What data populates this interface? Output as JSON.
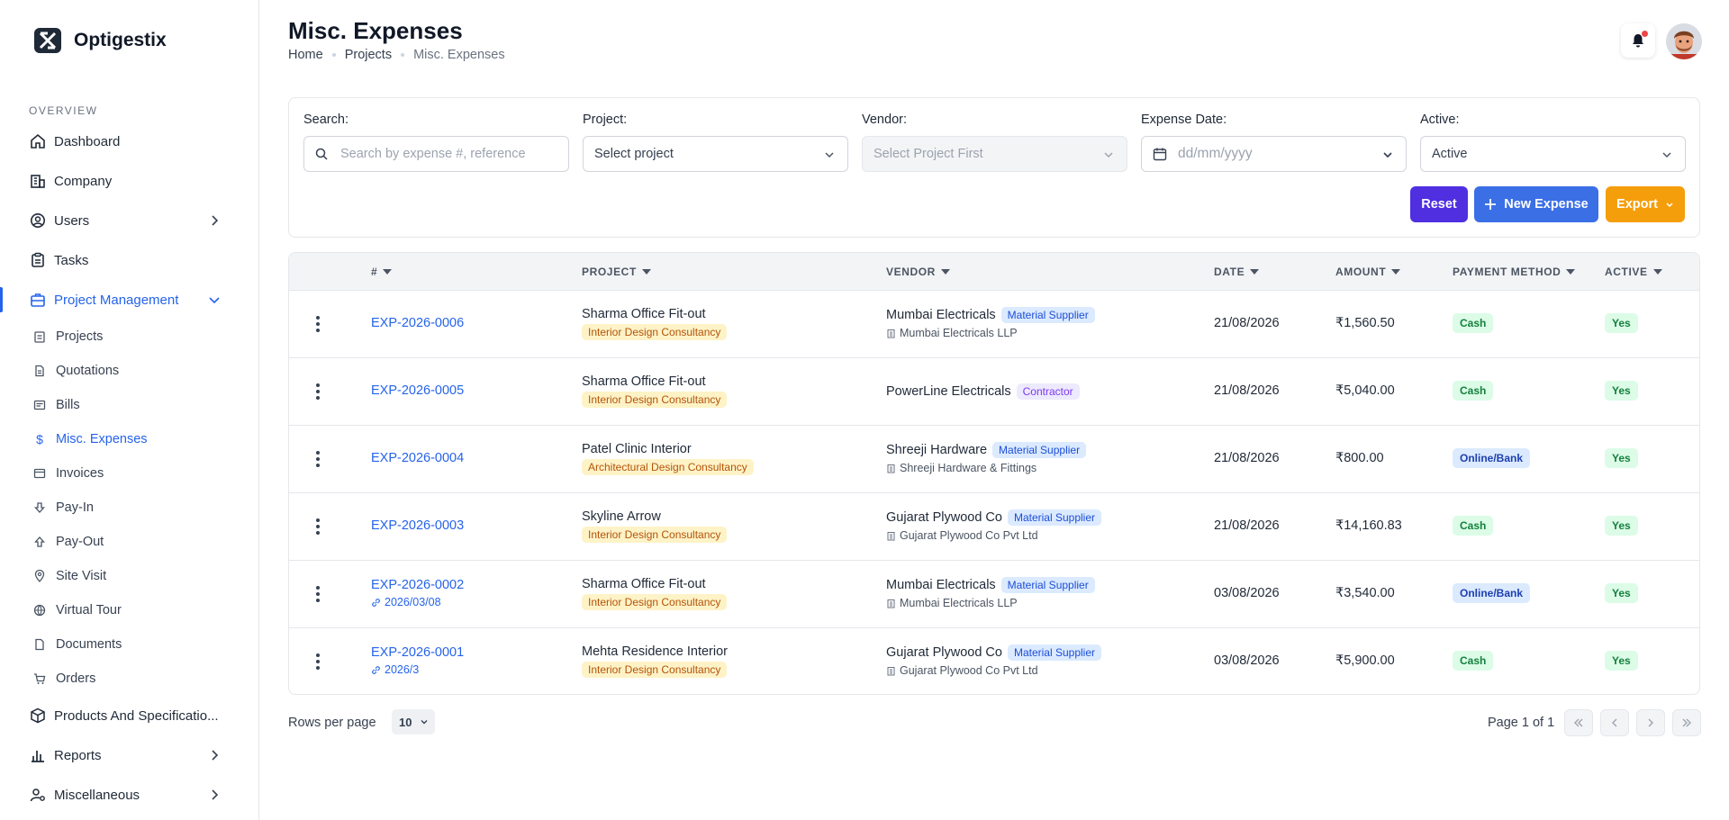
{
  "brand": {
    "name": "Optigestix"
  },
  "sidebar": {
    "section_label": "OVERVIEW",
    "items": [
      {
        "label": "Dashboard",
        "icon": "home-icon"
      },
      {
        "label": "Company",
        "icon": "building-icon"
      },
      {
        "label": "Users",
        "icon": "user-circle-icon",
        "expandable": true
      },
      {
        "label": "Tasks",
        "icon": "clipboard-icon"
      },
      {
        "label": "Project Management",
        "icon": "briefcase-icon",
        "expanded": true,
        "active": true
      }
    ],
    "sub_items": [
      {
        "label": "Projects",
        "icon": "clipboard-icon"
      },
      {
        "label": "Quotations",
        "icon": "document-icon"
      },
      {
        "label": "Bills",
        "icon": "receipt-icon"
      },
      {
        "label": "Misc. Expenses",
        "icon": "dollar-icon",
        "active": true
      },
      {
        "label": "Invoices",
        "icon": "invoice-icon"
      },
      {
        "label": "Pay-In",
        "icon": "arrow-down-icon"
      },
      {
        "label": "Pay-Out",
        "icon": "arrow-up-icon"
      },
      {
        "label": "Site Visit",
        "icon": "map-pin-icon"
      },
      {
        "label": "Virtual Tour",
        "icon": "globe-icon"
      },
      {
        "label": "Documents",
        "icon": "file-icon"
      },
      {
        "label": "Orders",
        "icon": "cart-icon"
      }
    ],
    "bottom_items": [
      {
        "label": "Products And Specificatio...",
        "icon": "box-icon"
      },
      {
        "label": "Reports",
        "icon": "bar-chart-icon",
        "expandable": true
      },
      {
        "label": "Miscellaneous",
        "icon": "user-settings-icon",
        "expandable": true
      }
    ]
  },
  "header": {
    "title": "Misc. Expenses",
    "breadcrumb": [
      "Home",
      "Projects",
      "Misc. Expenses"
    ]
  },
  "filters": {
    "search": {
      "label": "Search:",
      "placeholder": "Search by expense #, reference"
    },
    "project": {
      "label": "Project:",
      "value": "Select project"
    },
    "vendor": {
      "label": "Vendor:",
      "value": "Select Project First"
    },
    "date": {
      "label": "Expense Date:",
      "placeholder": "dd/mm/yyyy"
    },
    "active": {
      "label": "Active:",
      "value": "Active"
    },
    "buttons": {
      "reset": "Reset",
      "new": "New Expense",
      "export": "Export"
    }
  },
  "table": {
    "columns": [
      "#",
      "PROJECT",
      "VENDOR",
      "DATE",
      "AMOUNT",
      "PAYMENT METHOD",
      "ACTIVE"
    ],
    "rows": [
      {
        "id": "EXP-2026-0006",
        "ref": "",
        "project": "Sharma Office Fit-out",
        "project_tag": "Interior Design Consultancy",
        "vendor": "Mumbai Electricals",
        "vendor_tag": "Material Supplier",
        "vendor_tag_color": "blue",
        "vendor_sub": "Mumbai Electricals LLP",
        "date": "21/08/2026",
        "amount": "₹1,560.50",
        "payment": "Cash",
        "active": "Yes"
      },
      {
        "id": "EXP-2026-0005",
        "ref": "",
        "project": "Sharma Office Fit-out",
        "project_tag": "Interior Design Consultancy",
        "vendor": "PowerLine Electricals",
        "vendor_tag": "Contractor",
        "vendor_tag_color": "purple",
        "vendor_sub": "",
        "date": "21/08/2026",
        "amount": "₹5,040.00",
        "payment": "Cash",
        "active": "Yes"
      },
      {
        "id": "EXP-2026-0004",
        "ref": "",
        "project": "Patel Clinic Interior",
        "project_tag": "Architectural Design Consultancy",
        "vendor": "Shreeji Hardware",
        "vendor_tag": "Material Supplier",
        "vendor_tag_color": "blue",
        "vendor_sub": "Shreeji Hardware & Fittings",
        "date": "21/08/2026",
        "amount": "₹800.00",
        "payment": "Online/Bank",
        "active": "Yes"
      },
      {
        "id": "EXP-2026-0003",
        "ref": "",
        "project": "Skyline Arrow",
        "project_tag": "Interior Design Consultancy",
        "vendor": "Gujarat Plywood Co",
        "vendor_tag": "Material Supplier",
        "vendor_tag_color": "blue",
        "vendor_sub": "Gujarat Plywood Co Pvt Ltd",
        "date": "21/08/2026",
        "amount": "₹14,160.83",
        "payment": "Cash",
        "active": "Yes"
      },
      {
        "id": "EXP-2026-0002",
        "ref": "2026/03/08",
        "project": "Sharma Office Fit-out",
        "project_tag": "Interior Design Consultancy",
        "vendor": "Mumbai Electricals",
        "vendor_tag": "Material Supplier",
        "vendor_tag_color": "blue",
        "vendor_sub": "Mumbai Electricals LLP",
        "date": "03/08/2026",
        "amount": "₹3,540.00",
        "payment": "Online/Bank",
        "active": "Yes"
      },
      {
        "id": "EXP-2026-0001",
        "ref": "2026/3",
        "project": "Mehta Residence Interior",
        "project_tag": "Interior Design Consultancy",
        "vendor": "Gujarat Plywood Co",
        "vendor_tag": "Material Supplier",
        "vendor_tag_color": "blue",
        "vendor_sub": "Gujarat Plywood Co Pvt Ltd",
        "date": "03/08/2026",
        "amount": "₹5,900.00",
        "payment": "Cash",
        "active": "Yes"
      }
    ]
  },
  "pagination": {
    "rows_label": "Rows per page",
    "rows_value": "10",
    "page_info": "Page 1 of 1"
  },
  "colors": {
    "primary": "#2563eb",
    "reset": "#4f2fe0",
    "new": "#3b6fe6",
    "export": "#f59e0b"
  }
}
